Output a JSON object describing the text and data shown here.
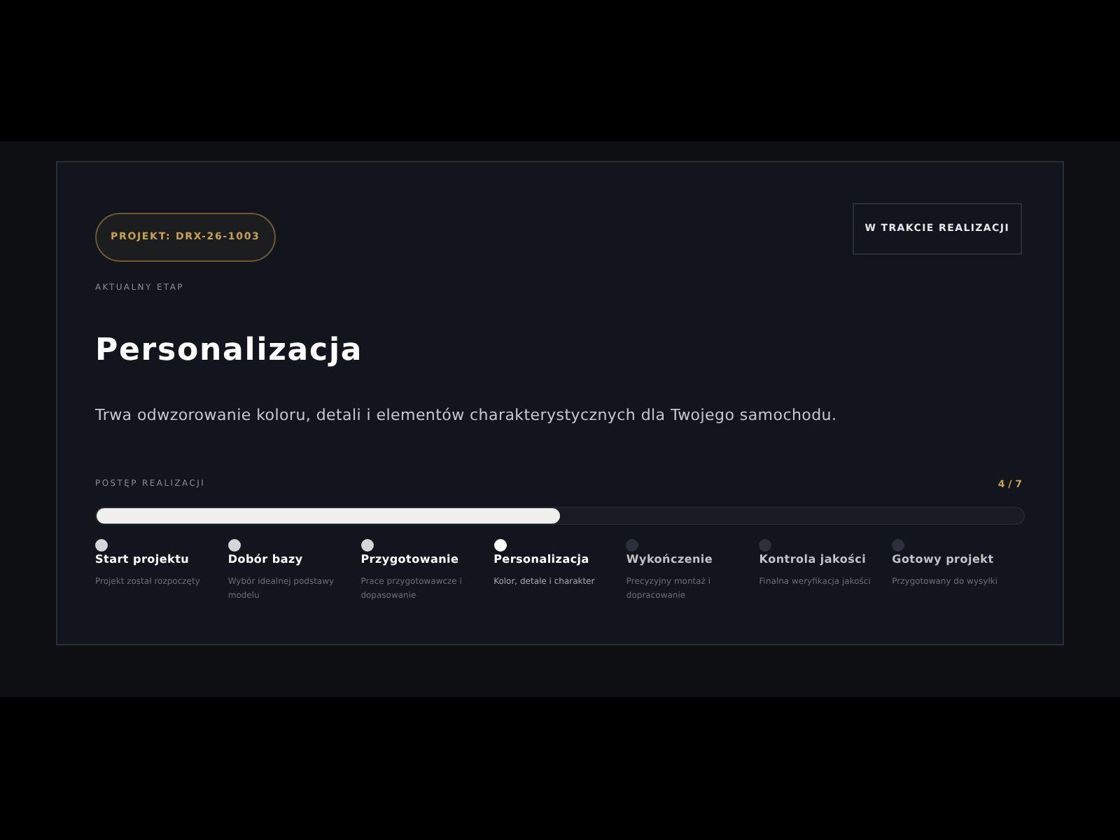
{
  "project_badge": "PROJEKT: DRX-26-1003",
  "status_badge": "W TRAKCIE REALIZACJI",
  "stage_label": "AKTUALNY ETAP",
  "stage_title": "Personalizacja",
  "stage_description": "Trwa odwzorowanie koloru, detali i elementów charakterystycznych dla Twojego samochodu.",
  "progress": {
    "label": "POSTĘP REALIZACJI",
    "count": "4 / 7",
    "level": 0.5
  },
  "steps": [
    {
      "title": "Start projektu",
      "description": "Projekt został rozpoczęty",
      "kind": "done"
    },
    {
      "title": "Dobór bazy",
      "description": "Wybór idealnej podstawy modelu",
      "kind": "done"
    },
    {
      "title": "Przygotowanie",
      "description": "Prace przygotowawcze i dopasowanie",
      "kind": "done"
    },
    {
      "title": "Personalizacja",
      "description": "Kolor, detale i charakter",
      "kind": "current"
    },
    {
      "title": "Wykończenie",
      "description": "Precyzyjny montaż i dopracowanie",
      "kind": "pending"
    },
    {
      "title": "Kontrola jakości",
      "description": "Finalna weryfikacja jakości",
      "kind": "pending"
    },
    {
      "title": "Gotowy projekt",
      "description": "Przygotowany do wysyłki",
      "kind": "pending"
    }
  ]
}
